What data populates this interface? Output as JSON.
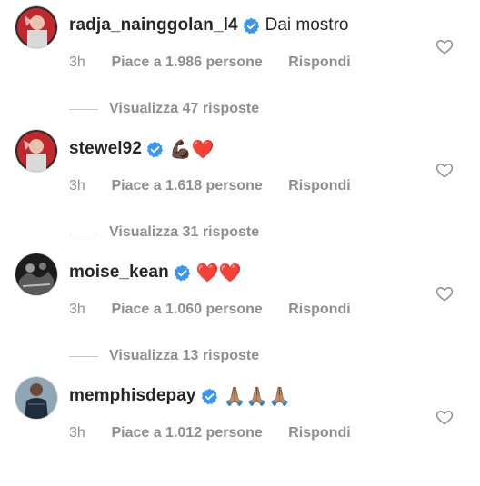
{
  "comments": [
    {
      "username": "radja_nainggolan_l4",
      "text": "Dai mostro",
      "emoji": "",
      "time": "3h",
      "likes": "Piace a 1.986 persone",
      "reply": "Rispondi",
      "replies": "Visualizza 47 risposte",
      "avatar_icon": "avatar-photo-icon"
    },
    {
      "username": "stewel92",
      "text": "",
      "emoji": "💪🏿❤️",
      "time": "3h",
      "likes": "Piace a 1.618 persone",
      "reply": "Rispondi",
      "replies": "Visualizza 31 risposte",
      "avatar_icon": "avatar-photo-icon"
    },
    {
      "username": "moise_kean",
      "text": "",
      "emoji": "❤️❤️",
      "time": "3h",
      "likes": "Piace a 1.060 persone",
      "reply": "Rispondi",
      "replies": "Visualizza 13 risposte",
      "avatar_icon": "avatar-photo-icon"
    },
    {
      "username": "memphisdepay",
      "text": "",
      "emoji": "🙏🏽🙏🏽🙏🏽",
      "time": "3h",
      "likes": "Piace a 1.012 persone",
      "reply": "Rispondi",
      "replies": "",
      "avatar_icon": "avatar-photo-icon"
    }
  ],
  "colors": {
    "text": "#262626",
    "secondary": "#8e8e8e",
    "verified": "#3897f0",
    "heart_stroke": "#8e8e8e"
  },
  "icons": {
    "verified": "verified-badge-icon",
    "like": "heart-outline-icon"
  }
}
